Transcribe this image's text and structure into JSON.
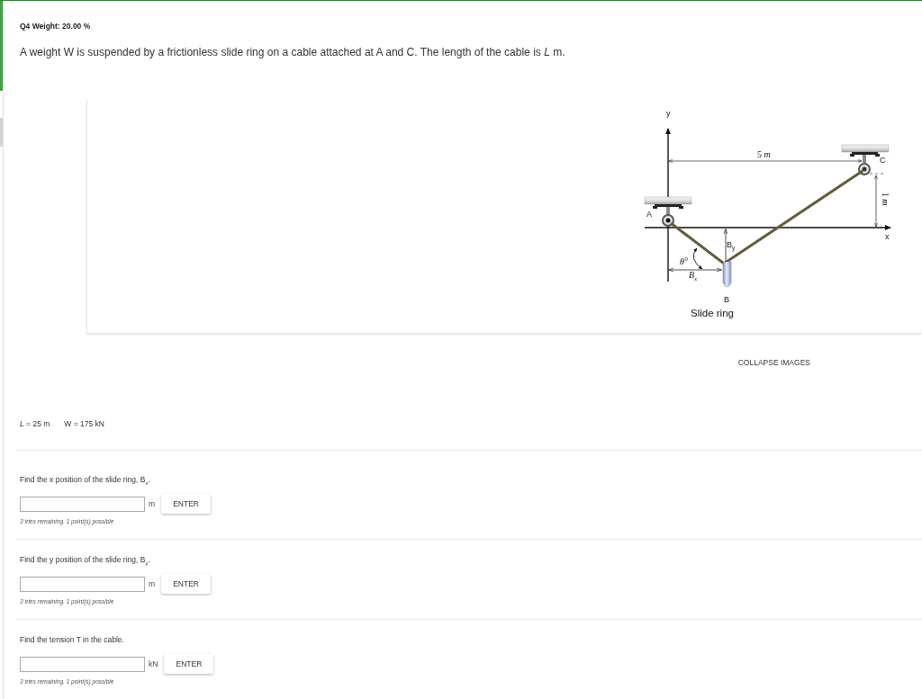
{
  "question": {
    "header": "Q4 Weight: 20.00 %",
    "statement": "A weight W is suspended by a frictionless slide ring on a cable attached at A and C. The length of the cable is *L* m."
  },
  "diagram": {
    "y_axis": "y",
    "span": "5 *m*",
    "point_c": "C",
    "point_a": "A",
    "rise": "1 *m*",
    "x_axis": "x",
    "force_y": "B$_{y}$",
    "angle": "θ°",
    "force_x": "B$_{x}$",
    "point_b": "B",
    "caption": "Slide ring"
  },
  "collapse_button": "COLLAPSE IMAGES",
  "givens": [
    "*L* = 25 m",
    "W = 175 kN"
  ],
  "parts": [
    {
      "prompt": "Find the x position of the slide ring, B$_{x}$.",
      "unit": "m",
      "button": "ENTER",
      "hint": "3 tries remaining. 1 point(s) possible"
    },
    {
      "prompt": "Find the y position of the slide ring, B$_{y}$.",
      "unit": "m",
      "button": "ENTER",
      "hint": "3 tries remaining. 1 point(s) possible"
    },
    {
      "prompt": "Find the tension T in the cable.",
      "unit": "kN",
      "button": "ENTER",
      "hint": "3 tries remaining. 1 point(s) possible"
    }
  ]
}
